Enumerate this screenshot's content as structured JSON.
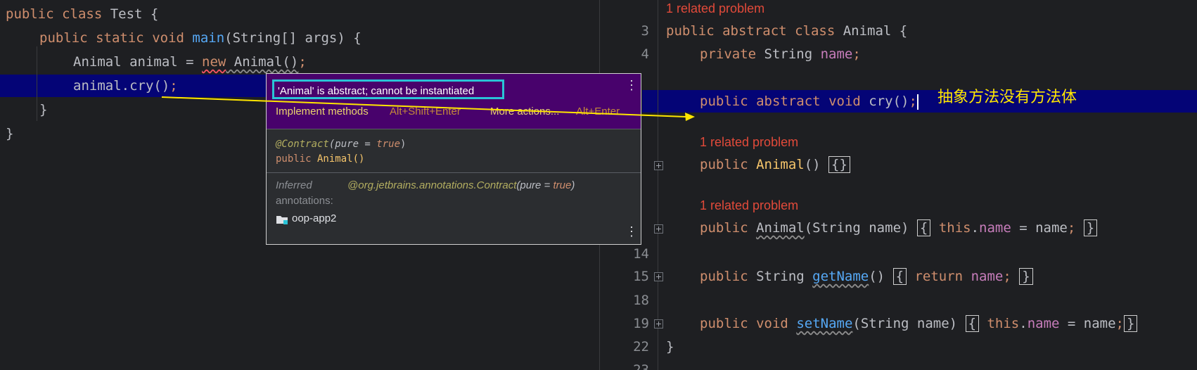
{
  "left_editor": {
    "lines": {
      "l1": {
        "kw1": "public",
        "kw2": "class",
        "rest": " Test {"
      },
      "l2": {
        "kw1": "public",
        "kw2": "static",
        "kw3": "void",
        "fn": "main",
        "rest": "(String[] args) {"
      },
      "l3": {
        "pre": "Animal animal = ",
        "new": "new",
        "ctor": " Animal()",
        "semi": ";"
      },
      "l4": {
        "code": "animal.cry()",
        "semi": ";"
      },
      "l5": {
        "text": "}"
      },
      "l6": {
        "text": "}"
      }
    }
  },
  "popup": {
    "title": "'Animal' is abstract; cannot be instantiated",
    "implement_label": "Implement methods",
    "implement_shortcut": "Alt+Shift+Enter",
    "more_label": "More actions...",
    "more_shortcut": "Alt+Enter",
    "contract_annotation": "@Contract",
    "contract_args_open": "(pure = ",
    "contract_true": "true",
    "contract_args_close": ")",
    "signature_kw": "public",
    "signature_rest": " Animal()",
    "inferred_label": "Inferred",
    "inferred_value": "@org.jetbrains.annotations.Contract",
    "inferred_args_open": "(pure = ",
    "inferred_true": "true",
    "inferred_args_close": ")",
    "annotations_label": "annotations:",
    "module_name": "oop-app2",
    "module_icon": "folder-module-icon"
  },
  "right_editor": {
    "related_problem": "1 related problem",
    "line_numbers": [
      "3",
      "4",
      "14",
      "15",
      "18",
      "19",
      "22",
      "23"
    ],
    "lines": {
      "class_decl": {
        "kw1": "public",
        "kw2": "abstract",
        "kw3": "class",
        "rest": " Animal {"
      },
      "field": {
        "kw1": "private",
        "type": " String ",
        "name": "name",
        "semi": ";"
      },
      "abstract_method": {
        "kw1": "public",
        "kw2": "abstract",
        "kw3": "void",
        "rest": " cry()",
        "semi": ";"
      },
      "ctor_empty": {
        "kw1": "public",
        "name": " Animal",
        "paren": "() ",
        "body": "{}"
      },
      "ctor_param": {
        "kw1": "public",
        "name": "Animal",
        "params": "(String name)",
        "open": "{",
        "this": "this",
        "dot": ".",
        "field": "name",
        "assign": " = name",
        "semi": ";",
        "close": "}"
      },
      "getter": {
        "kw1": "public",
        "type": " String ",
        "name": "getName",
        "paren": "()",
        "open": "{",
        "ret": "return",
        "field": "name",
        "semi": ";",
        "close": "}"
      },
      "setter": {
        "kw1": "public",
        "kw2": "void",
        "name": "setName",
        "params": "(String name)",
        "open": "{",
        "this": "this",
        "dot": ".",
        "field": "name",
        "assign": " = name",
        "semi": ";",
        "close": "}"
      },
      "end": "}"
    }
  },
  "annotation_text": "抽象方法没有方法体",
  "colors": {
    "accent_popup": "#48026c",
    "highlight_box": "#2ac3d6",
    "arrow": "#ffe600",
    "error_text": "#e24a3a"
  }
}
